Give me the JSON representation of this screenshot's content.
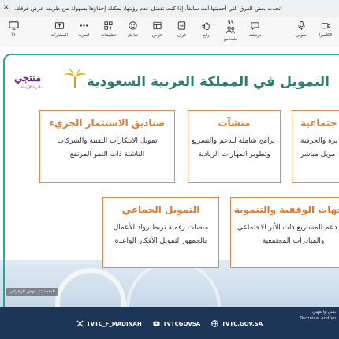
{
  "banner": {
    "text": "أتحدث بعض الفرق التي أحميتها أنت سابقاً. إذا كنت تفضل عدم رؤيتها، يمكنك إخفاؤها بسهولة من طريقة عرض فرقك."
  },
  "toolbar": {
    "left_label": "الأ",
    "participants_count": "33",
    "buttons": [
      {
        "icon": "share-icon",
        "label": "المشاركة"
      },
      {
        "icon": "more-icon",
        "label": "المزيد"
      },
      {
        "icon": "apps-icon",
        "label": "تطبيقات"
      },
      {
        "icon": "react-icon",
        "label": "تفاعل"
      },
      {
        "icon": "view-icon",
        "label": "عرض"
      },
      {
        "icon": "notes-icon",
        "label": "غرف"
      },
      {
        "icon": "raise-hand-icon",
        "label": "رفع"
      },
      {
        "icon": "people-icon",
        "label": "أشخاص"
      },
      {
        "icon": "chat-icon",
        "label": "دردشة"
      }
    ],
    "right_buttons": [
      {
        "icon": "mic-icon",
        "label": "صوتي"
      },
      {
        "icon": "camera-icon",
        "label": "الكاميرا"
      }
    ]
  },
  "slide": {
    "logo_text": "منتجي",
    "logo_tagline": "مبادرة الإرشاد",
    "title": "التمويل في المملكة العربية السعودية",
    "cards": [
      {
        "head": "صناديق الاستثمار الجريء",
        "lines": [
          "تمويل الابتكارات التقنية والشركات",
          "الناشئة ذات النمو المرتفع"
        ]
      },
      {
        "head": "منشآت",
        "lines": [
          "برامج شاملة للدعم والتسريع",
          "وتطوير المهارات الريادية"
        ]
      },
      {
        "head": "جتماعية",
        "lines": [
          "يرة والحرفية",
          "مويل مباشر"
        ]
      },
      {
        "head": "التمويل الجماعي",
        "lines": [
          "منصات رقمية تربط رواد الأعمال",
          "بالجمهور لتمويل الأفكار الواعدة"
        ]
      },
      {
        "head": "الجهات الوقفية والتنموية",
        "lines": [
          "دعم المشاريع ذات الأثر الاجتماعي",
          "والمبادرات المجتمعية"
        ]
      }
    ],
    "presenter_label": "المتحدث: عوض الزهراني"
  },
  "footer": {
    "dept_line1": "نقني والمهني",
    "dept_line2": "Technical and Vo",
    "socials": [
      {
        "icon": "x-icon",
        "label": "TVTC_F_MADINAH"
      },
      {
        "icon": "youtube-icon",
        "label": "TVTCGOVSA"
      },
      {
        "icon": "web-icon",
        "label": "TVTC.GOV.SA"
      }
    ]
  },
  "colors": {
    "teal": "#2e7d74",
    "orange": "#e07a2e",
    "navy": "#1d3556",
    "logo_purple": "#6a2a83"
  }
}
